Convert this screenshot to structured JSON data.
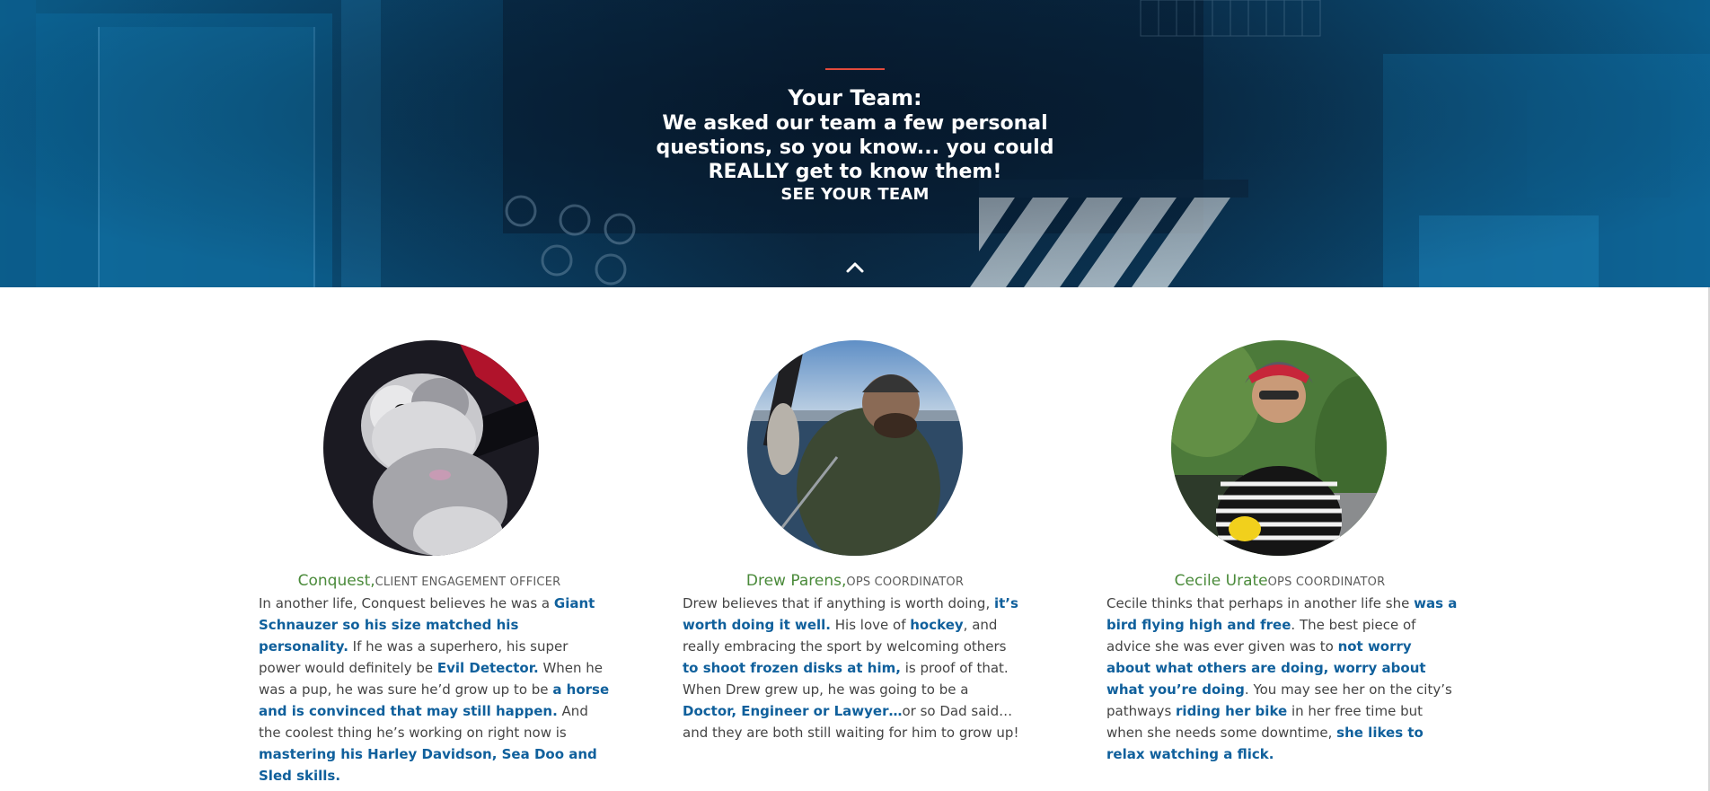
{
  "hero": {
    "title": "Your Team:",
    "subtitle": "We asked our team a few personal questions, so you know... you could REALLY get to know them!",
    "cta_label": "SEE YOUR TEAM",
    "accent_color": "#e24a3c",
    "scroll_icon": "chevron-up-icon"
  },
  "team": [
    {
      "name": "Conquest,",
      "role": "CLIENT ENGAGEMENT OFFICER",
      "bio": [
        {
          "t": "In another life, Conquest believes he was a "
        },
        {
          "t": "Giant Schnauzer so his size matched his personality.",
          "b": true
        },
        {
          "t": " If he was a superhero, his super power would definitely be "
        },
        {
          "t": "Evil Detector.",
          "b": true
        },
        {
          "t": " When he was a pup, he was sure he’d grow up to be "
        },
        {
          "t": "a horse and is convinced that may still happen.",
          "b": true
        },
        {
          "t": " And the coolest thing he’s working on right now is "
        },
        {
          "t": "mastering his Harley Davidson, Sea Doo and Sled skills.",
          "b": true
        }
      ]
    },
    {
      "name": "Drew Parens,",
      "role": "OPS COORDINATOR",
      "bio": [
        {
          "t": "Drew believes that if anything is worth doing, "
        },
        {
          "t": "it’s worth doing it well.",
          "b": true
        },
        {
          "t": " His love of "
        },
        {
          "t": "hockey",
          "b": true
        },
        {
          "t": ", and really embracing the sport by welcoming others "
        },
        {
          "t": "to shoot frozen disks at him,",
          "b": true
        },
        {
          "t": " is proof of that. When Drew grew up, he was going to be a "
        },
        {
          "t": "Doctor, Engineer or Lawyer…",
          "b": true
        },
        {
          "t": "or so Dad said… and they are both still waiting for him to grow up!"
        }
      ]
    },
    {
      "name": "Cecile Urate",
      "role": "OPS COORDINATOR",
      "bio": [
        {
          "t": "Cecile thinks that perhaps in another life she "
        },
        {
          "t": "was a bird flying high and free",
          "b": true
        },
        {
          "t": ". The best piece of advice she was ever given was to "
        },
        {
          "t": "not worry about what others are doing, worry about what you’re doing",
          "b": true
        },
        {
          "t": ". You may see her on the city’s pathways "
        },
        {
          "t": "riding her bike",
          "b": true
        },
        {
          "t": " in her free time but when she needs some downtime, "
        },
        {
          "t": "she likes to relax watching a flick.",
          "b": true
        }
      ]
    }
  ],
  "colors": {
    "name": "#4a8a3a",
    "highlight": "#10609c",
    "body_text": "#444444"
  }
}
